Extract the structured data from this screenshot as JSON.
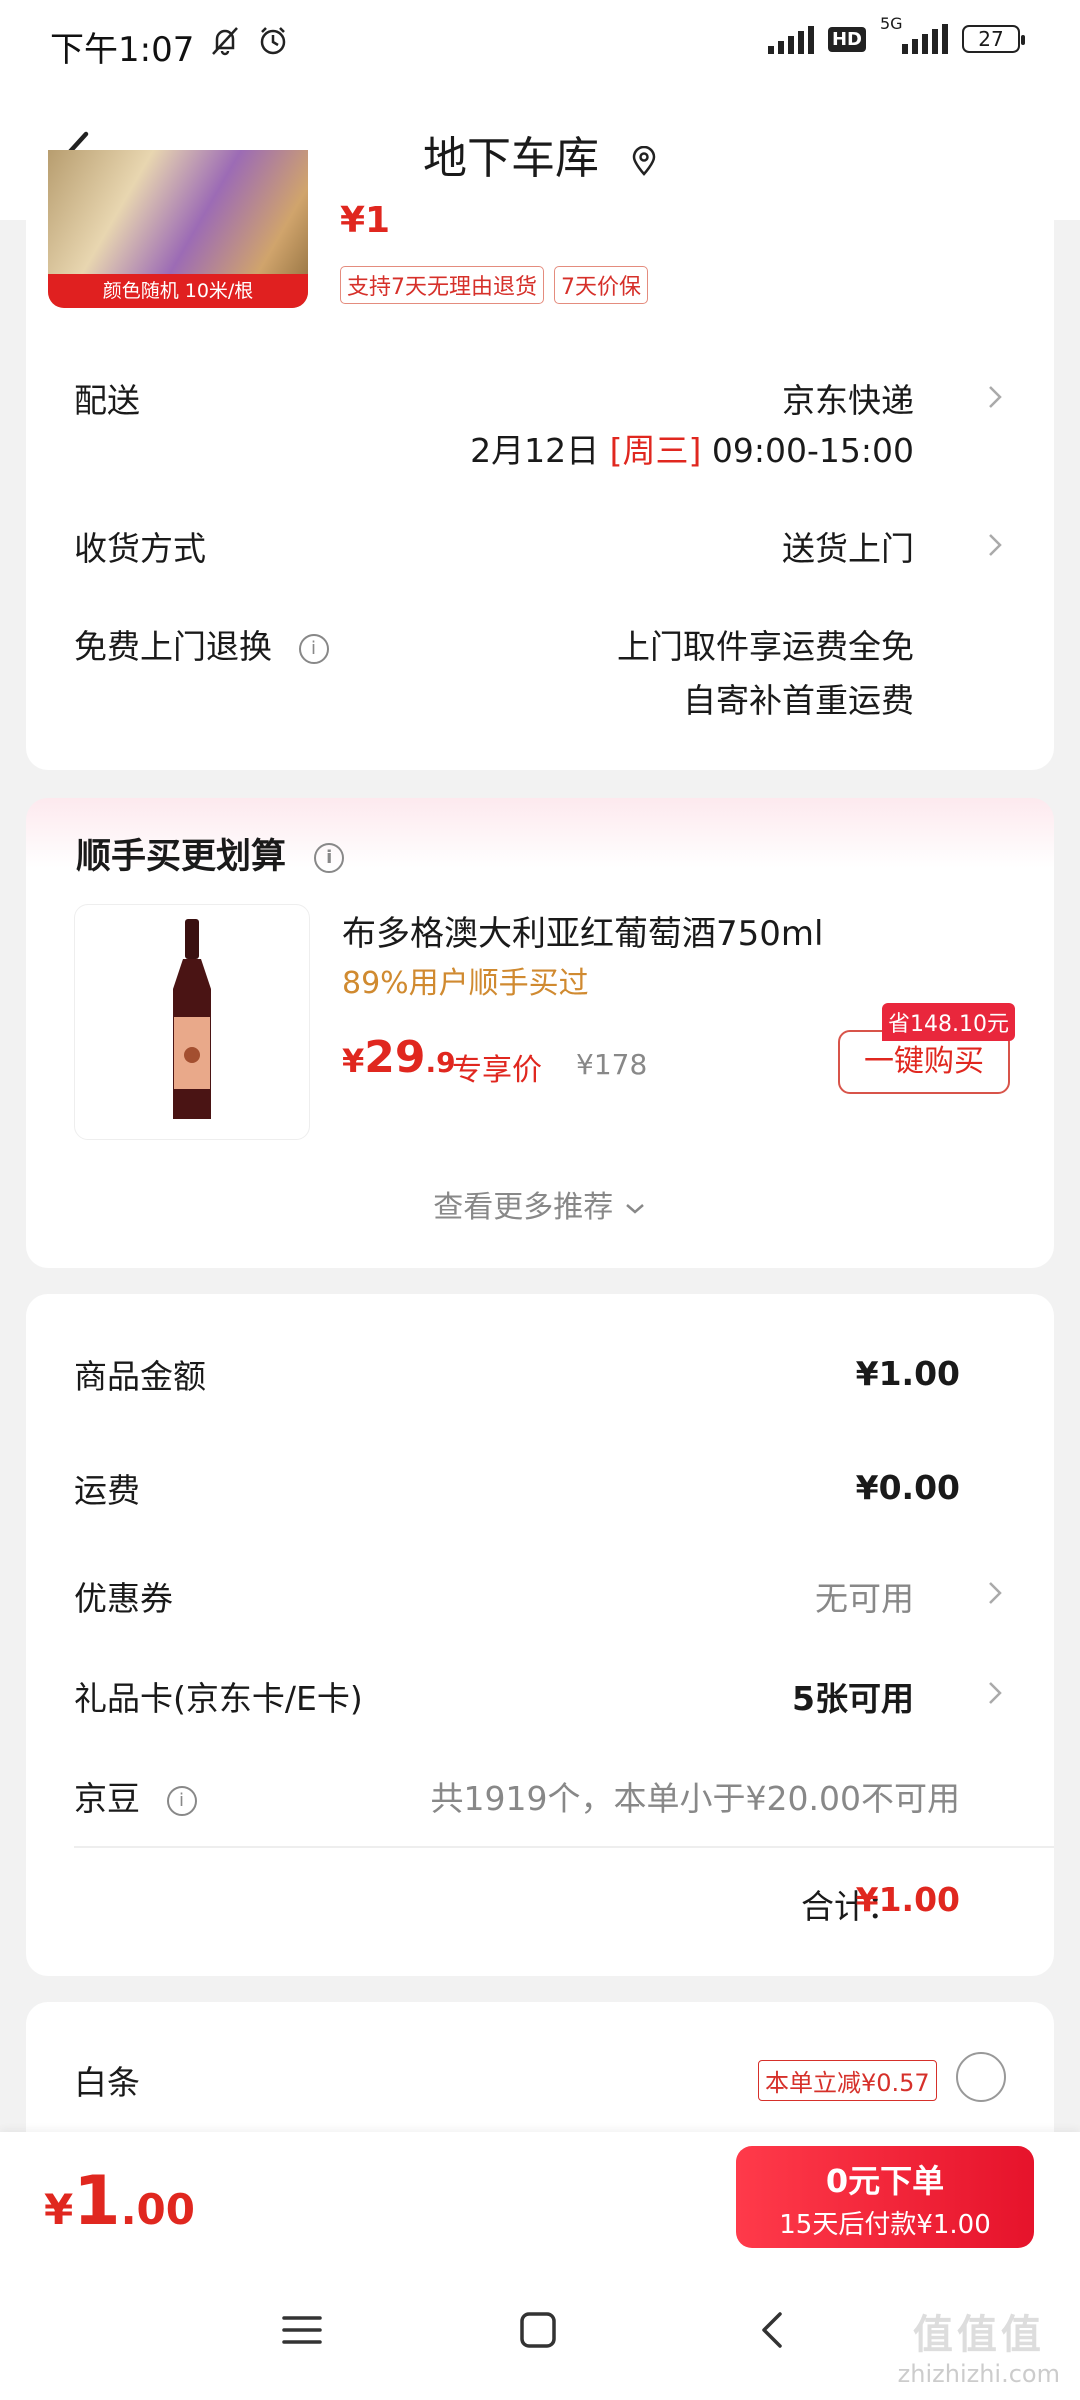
{
  "status_bar": {
    "time": "下午1:07",
    "network": "5G",
    "hd": "HD",
    "battery": "27"
  },
  "nav": {
    "title": "地下车库"
  },
  "product": {
    "price_fragment": "¥1",
    "thumb_caption": "颜色随机 10米/根",
    "tags": [
      "支持7天无理由退货",
      "7天价保"
    ]
  },
  "delivery": {
    "label": "配送",
    "carrier": "京东快递",
    "date": "2月12日",
    "weekday": "[周三]",
    "time": "09:00-15:00"
  },
  "receive": {
    "label": "收货方式",
    "value": "送货上门"
  },
  "free_return": {
    "label": "免费上门退换",
    "line1": "上门取件享运费全免",
    "line2": "自寄补首重运费"
  },
  "recommend": {
    "title": "顺手买更划算",
    "item_name": "布多格澳大利亚红葡萄酒750ml",
    "item_sub": "89%用户顺手买过",
    "price_sym": "¥",
    "price_int": "29",
    "price_dec": ".9",
    "price_label": "专享价",
    "orig_price": "¥178",
    "save_badge": "省148.10元",
    "buy_button": "一键购买",
    "more": "查看更多推荐"
  },
  "summary": {
    "goods_label": "商品金额",
    "goods_value": "¥1.00",
    "shipping_label": "运费",
    "shipping_value": "¥0.00",
    "coupon_label": "优惠券",
    "coupon_value": "无可用",
    "giftcard_label": "礼品卡(京东卡/E卡)",
    "giftcard_value": "5张可用",
    "jingdou_label": "京豆",
    "jingdou_value": "共1919个，本单小于¥20.00不可用",
    "total_label": "合计：",
    "total_value": "¥1.00"
  },
  "baitiao": {
    "label": "白条",
    "promo": "本单立减¥0.57"
  },
  "bottom": {
    "pay_sym": "¥",
    "pay_int": "1",
    "pay_dec": ".00",
    "order_main": "0元下单",
    "order_sub": "15天后付款¥1.00"
  },
  "watermark": {
    "logo": "值值值",
    "url": "zhizhizhi.com"
  },
  "colors": {
    "accent": "#e0271f",
    "button_gradient_start": "#ff3a4a",
    "button_gradient_end": "#e6132b",
    "muted": "#888888"
  }
}
